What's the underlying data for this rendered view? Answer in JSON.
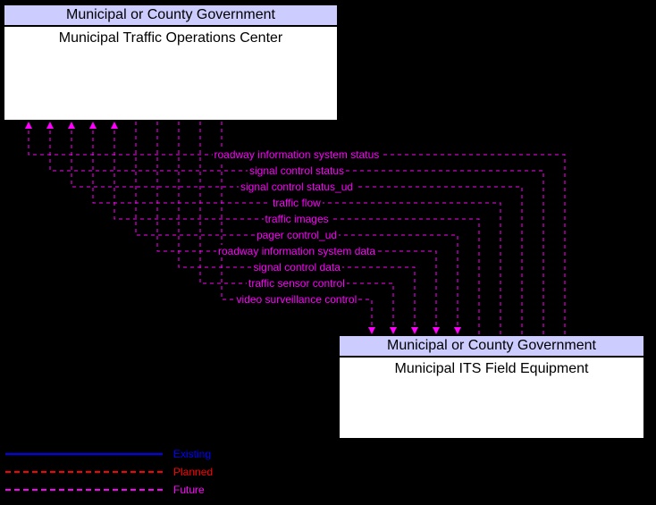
{
  "entities": {
    "e1": {
      "header": "Municipal or County Government",
      "body": "Municipal Traffic Operations Center"
    },
    "e2": {
      "header": "Municipal or County Government",
      "body": "Municipal ITS Field Equipment"
    }
  },
  "flows": [
    {
      "label": "roadway information system status",
      "dir": "up"
    },
    {
      "label": "signal control status",
      "dir": "up"
    },
    {
      "label": "signal control status_ud",
      "dir": "up"
    },
    {
      "label": "traffic flow",
      "dir": "up"
    },
    {
      "label": "traffic images",
      "dir": "up"
    },
    {
      "label": "pager control_ud",
      "dir": "down"
    },
    {
      "label": "roadway information system data",
      "dir": "down"
    },
    {
      "label": "signal control data",
      "dir": "down"
    },
    {
      "label": "traffic sensor control",
      "dir": "down"
    },
    {
      "label": "video surveillance control",
      "dir": "down"
    }
  ],
  "legend": {
    "existing": "Existing",
    "planned": "Planned",
    "future": "Future"
  },
  "chart_data": {
    "type": "diagram",
    "nodes": [
      {
        "id": "mtoc",
        "owner": "Municipal or County Government",
        "name": "Municipal Traffic Operations Center"
      },
      {
        "id": "mife",
        "owner": "Municipal or County Government",
        "name": "Municipal ITS Field Equipment"
      }
    ],
    "edges": [
      {
        "from": "mife",
        "to": "mtoc",
        "label": "roadway information system status",
        "status": "Future"
      },
      {
        "from": "mife",
        "to": "mtoc",
        "label": "signal control status",
        "status": "Future"
      },
      {
        "from": "mife",
        "to": "mtoc",
        "label": "signal control status_ud",
        "status": "Future"
      },
      {
        "from": "mife",
        "to": "mtoc",
        "label": "traffic flow",
        "status": "Future"
      },
      {
        "from": "mife",
        "to": "mtoc",
        "label": "traffic images",
        "status": "Future"
      },
      {
        "from": "mtoc",
        "to": "mife",
        "label": "pager control_ud",
        "status": "Future"
      },
      {
        "from": "mtoc",
        "to": "mife",
        "label": "roadway information system data",
        "status": "Future"
      },
      {
        "from": "mtoc",
        "to": "mife",
        "label": "signal control data",
        "status": "Future"
      },
      {
        "from": "mtoc",
        "to": "mife",
        "label": "traffic sensor control",
        "status": "Future"
      },
      {
        "from": "mtoc",
        "to": "mife",
        "label": "video surveillance control",
        "status": "Future"
      }
    ],
    "legend": [
      "Existing",
      "Planned",
      "Future"
    ]
  }
}
